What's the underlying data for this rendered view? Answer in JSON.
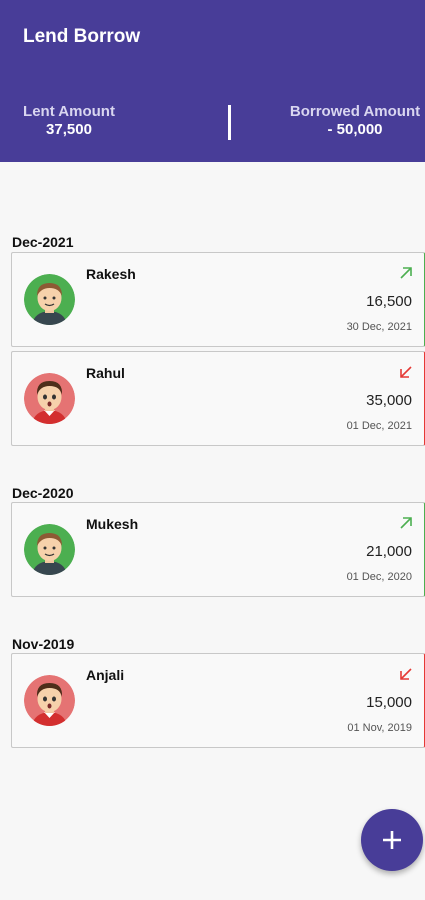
{
  "app": {
    "title": "Lend Borrow"
  },
  "summary": {
    "lent_label": "Lent Amount",
    "lent_value": "37,500",
    "borrowed_label": "Borrowed Amount",
    "borrowed_value": "- 50,000"
  },
  "colors": {
    "primary": "#483d98",
    "lent": "#4caf50",
    "borrowed": "#e53935"
  },
  "sections": [
    {
      "header": "Dec-2021",
      "items": [
        {
          "name": "Rakesh",
          "amount": "16,500",
          "date": "30 Dec, 2021",
          "type": "lent",
          "icon": "arrow-up-right-icon"
        },
        {
          "name": "Rahul",
          "amount": "35,000",
          "date": "01 Dec, 2021",
          "type": "borrowed",
          "icon": "arrow-down-left-icon"
        }
      ]
    },
    {
      "header": "Dec-2020",
      "items": [
        {
          "name": "Mukesh",
          "amount": "21,000",
          "date": "01 Dec, 2020",
          "type": "lent",
          "icon": "arrow-up-right-icon"
        }
      ]
    },
    {
      "header": "Nov-2019",
      "items": [
        {
          "name": "Anjali",
          "amount": "15,000",
          "date": "01 Nov, 2019",
          "type": "borrowed",
          "icon": "arrow-down-left-icon"
        }
      ]
    }
  ],
  "fab": {
    "icon": "plus-icon"
  }
}
